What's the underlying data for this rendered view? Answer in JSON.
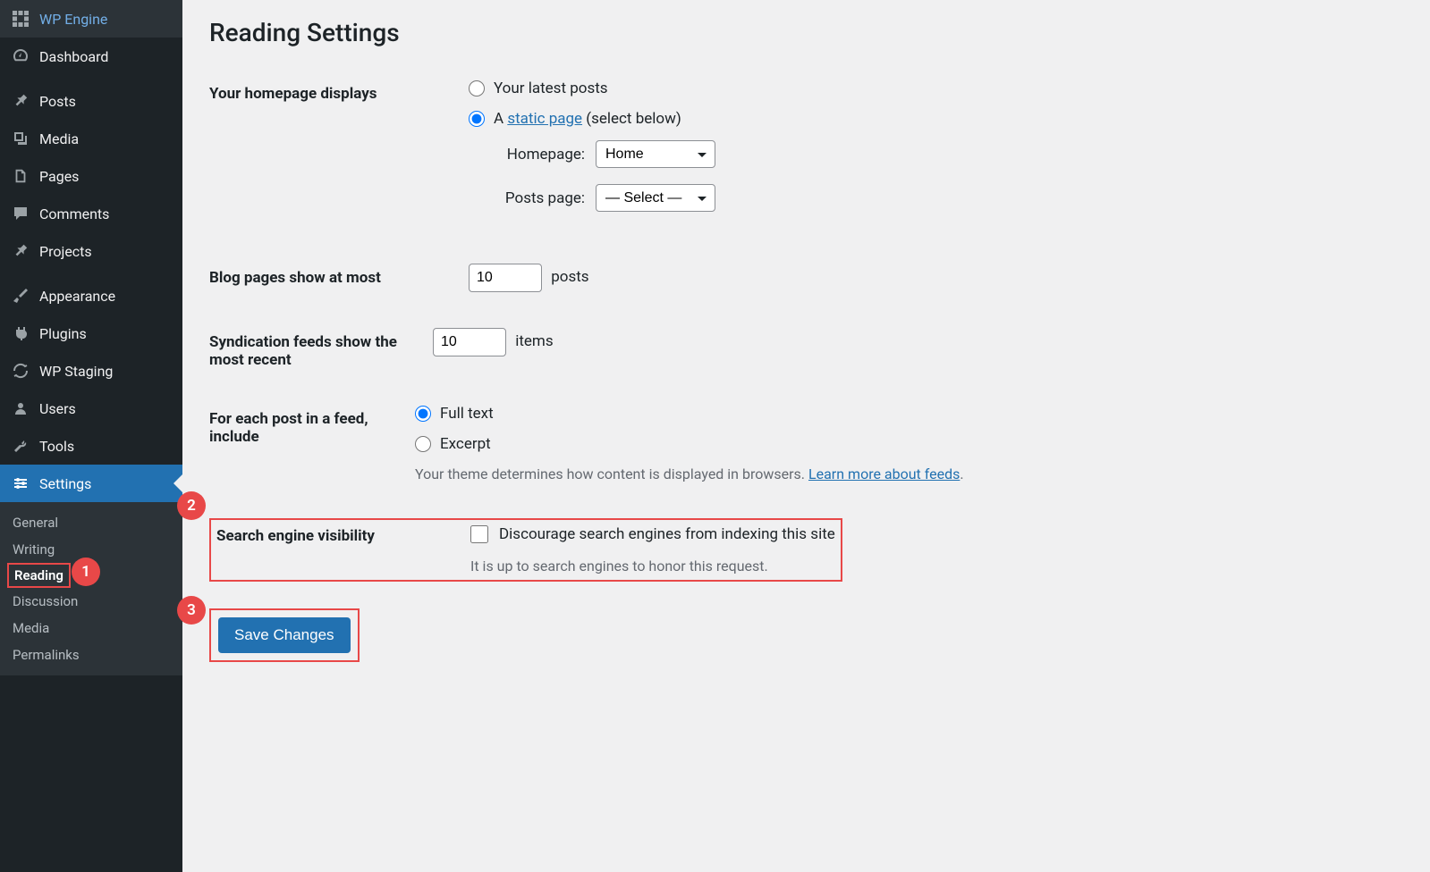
{
  "sidebar": {
    "items": [
      {
        "label": "WP Engine"
      },
      {
        "label": "Dashboard"
      },
      {
        "label": "Posts"
      },
      {
        "label": "Media"
      },
      {
        "label": "Pages"
      },
      {
        "label": "Comments"
      },
      {
        "label": "Projects"
      },
      {
        "label": "Appearance"
      },
      {
        "label": "Plugins"
      },
      {
        "label": "WP Staging"
      },
      {
        "label": "Users"
      },
      {
        "label": "Tools"
      },
      {
        "label": "Settings"
      }
    ],
    "subitems": [
      {
        "label": "General"
      },
      {
        "label": "Writing"
      },
      {
        "label": "Reading"
      },
      {
        "label": "Discussion"
      },
      {
        "label": "Media"
      },
      {
        "label": "Permalinks"
      }
    ]
  },
  "page": {
    "title": "Reading Settings",
    "homepage_displays": {
      "label": "Your homepage displays",
      "opt1": "Your latest posts",
      "opt2_prefix": "A ",
      "opt2_link": "static page",
      "opt2_suffix": " (select below)",
      "homepage_label": "Homepage:",
      "homepage_value": "Home",
      "posts_page_label": "Posts page:",
      "posts_page_value": "— Select —"
    },
    "blog_pages": {
      "label": "Blog pages show at most",
      "value": "10",
      "suffix": "posts"
    },
    "syndication": {
      "label": "Syndication feeds show the most recent",
      "value": "10",
      "suffix": "items"
    },
    "feed_include": {
      "label": "For each post in a feed, include",
      "opt1": "Full text",
      "opt2": "Excerpt",
      "desc_prefix": "Your theme determines how content is displayed in browsers. ",
      "desc_link": "Learn more about feeds",
      "desc_suffix": "."
    },
    "sev": {
      "label": "Search engine visibility",
      "checkbox_label": "Discourage search engines from indexing this site",
      "desc": "It is up to search engines to honor this request."
    },
    "save": "Save Changes"
  },
  "annotations": {
    "b1": "1",
    "b2": "2",
    "b3": "3"
  }
}
